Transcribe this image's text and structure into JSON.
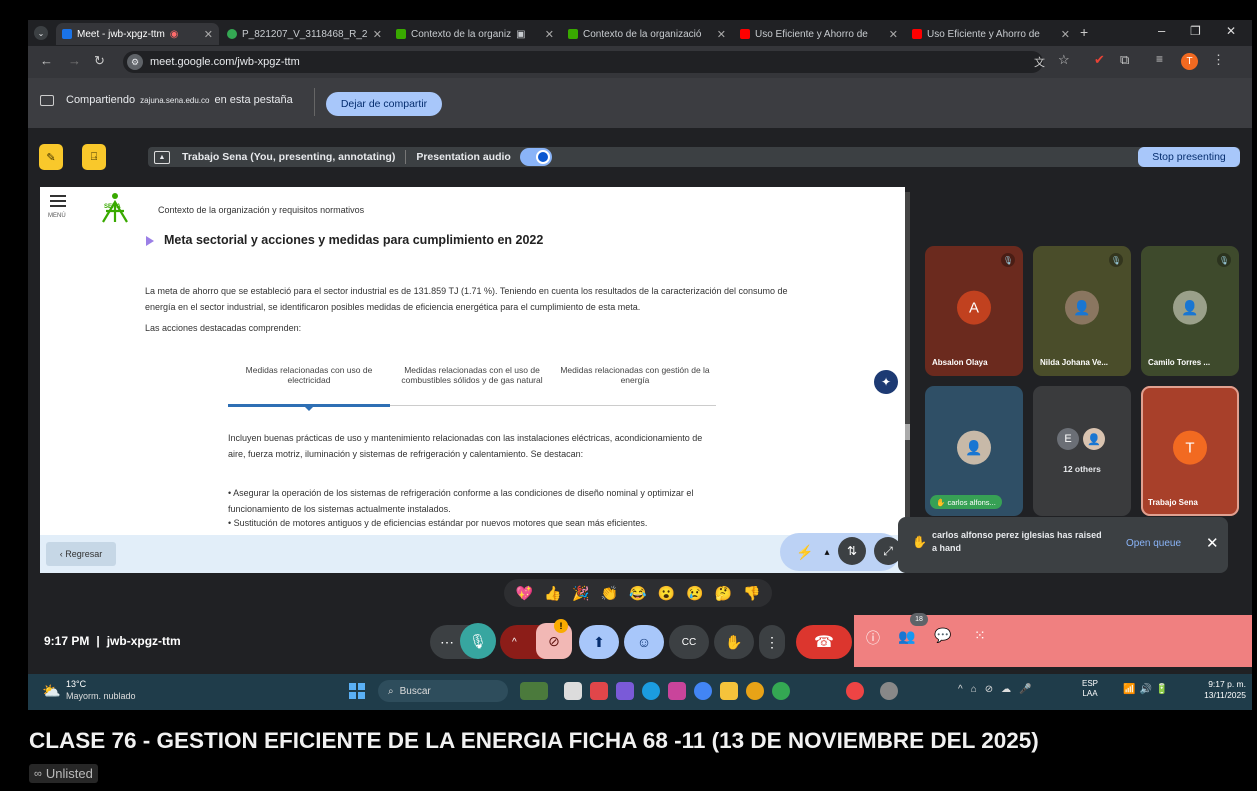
{
  "browser": {
    "tabs": [
      {
        "label": "Meet - jwb-xpgz-ttm",
        "color": "#1a73e8"
      },
      {
        "label": "P_821207_V_3118468_R_2",
        "color": "#34a853"
      },
      {
        "label": "Contexto de la organiz",
        "color": "#39a900"
      },
      {
        "label": "Contexto de la organizació",
        "color": "#39a900"
      },
      {
        "label": "Uso Eficiente y Ahorro de",
        "color": "#ff0000"
      },
      {
        "label": "Uso Eficiente y Ahorro de",
        "color": "#ff0000"
      }
    ],
    "new_tab": "+",
    "url": "meet.google.com/jwb-xpgz-ttm",
    "profile_initial": "T"
  },
  "share_bar": {
    "prefix": "Compartiendo",
    "domain": "zajuna.sena.edu.co",
    "suffix": "en esta pestaña",
    "stop_button": "Dejar de compartir"
  },
  "presenting": {
    "title": "Trabajo Sena (You, presenting, annotating)",
    "audio_label": "Presentation audio",
    "stop_button": "Stop presenting"
  },
  "slide": {
    "menu_label": "MENÚ",
    "logo_text": "SENA",
    "breadcrumb": "Contexto de la organización y requisitos normativos",
    "heading": "Meta sectorial y acciones y medidas para cumplimiento en 2022",
    "intro": "La meta de ahorro que se estableció para el sector industrial es de 131.859 TJ (1.71 %). Teniendo en cuenta los resultados de la caracterización del consumo de energía en el sector industrial, se identificaron posibles medidas de eficiencia energética para el cumplimiento de esta meta.",
    "acciones": "Las acciones destacadas comprenden:",
    "tabs": [
      "Medidas relacionadas con uso de electricidad",
      "Medidas relacionadas con el uso de combustibles sólidos y de gas natural",
      "Medidas relacionadas con gestión de la energía"
    ],
    "body": "Incluyen buenas prácticas de uso y mantenimiento relacionadas con las instalaciones eléctricas, acondicionamiento de aire, fuerza motriz, iluminación y sistemas de refrigeración y calentamiento. Se destacan:",
    "bullets": [
      "• Asegurar la operación de los sistemas de refrigeración conforme a las condiciones de diseño nominal y optimizar el funcionamiento de los sistemas actualmente instalados.",
      "• Sustitución de motores antiguos y de eficiencias estándar por nuevos motores que sean más eficientes."
    ],
    "back_button": "‹ Regresar"
  },
  "participants": [
    {
      "name": "Absalon Olaya",
      "initial": "A",
      "bg": "#6b2a1e",
      "avatar": "#c1411f"
    },
    {
      "name": "Nilda Johana Ve...",
      "initial": "",
      "bg": "#4a4d2a",
      "avatar": "#8a7660"
    },
    {
      "name": "Camilo Torres ...",
      "initial": "",
      "bg": "#3e4a2c",
      "avatar": "#9aa08a"
    },
    {
      "name": "carlos alfons...",
      "initial": "",
      "bg": "#2f4f66",
      "avatar": "#c7b9a8"
    },
    {
      "name": "12 others",
      "initial": "E",
      "bg": "#3a3b3d",
      "avatar": "#6b6f76"
    },
    {
      "name": "Trabajo Sena",
      "initial": "T",
      "bg": "#a8402a",
      "avatar": "#f26a21"
    }
  ],
  "notification": {
    "text": "carlos alfonso perez iglesias has raised a hand",
    "action": "Open queue"
  },
  "reactions": [
    "💖",
    "👍",
    "🎉",
    "👏",
    "😂",
    "😮",
    "😢",
    "🤔",
    "👎"
  ],
  "meeting": {
    "time": "9:17 PM",
    "separator": "|",
    "code": "jwb-xpgz-ttm",
    "people_count": "18",
    "warning_badge": "!"
  },
  "taskbar": {
    "temperature": "13°C",
    "weather": "Mayorm. nublado",
    "search": "Buscar",
    "lang1": "ESP",
    "lang2": "LAA",
    "clock_time": "9:17 p. m.",
    "clock_date": "13/11/2025"
  },
  "video": {
    "title": "CLASE 76 - GESTION EFICIENTE DE LA ENERGIA FICHA 68 -11 (13 DE NOVIEMBRE DEL 2025)",
    "visibility": "Unlisted"
  }
}
